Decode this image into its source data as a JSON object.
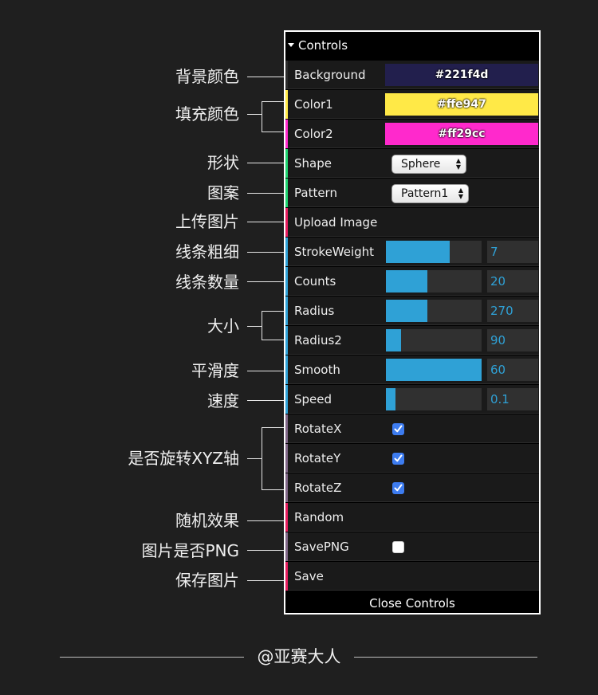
{
  "colors": {
    "background": "#1f1f1f",
    "slider_fill": "#2fa1d6",
    "panel_bg": "#1a1a1a",
    "stripe_color": "#806787",
    "stripe_boolean": "#806787",
    "stripe_number": "#2fa1d6",
    "stripe_function": "#e61d5f",
    "stripe_string": "#1ed36f"
  },
  "panel": {
    "title": "Controls",
    "close_label": "Close Controls",
    "rows": [
      {
        "label": "Background",
        "value": "#221f4d"
      },
      {
        "label": "Color1",
        "value": "#ffe947"
      },
      {
        "label": "Color2",
        "value": "#ff29cc"
      },
      {
        "label": "Shape",
        "value": "Sphere"
      },
      {
        "label": "Pattern",
        "value": "Pattern1"
      },
      {
        "label": "Upload Image"
      },
      {
        "label": "StrokeWeight",
        "value": "7",
        "fill": 0.67
      },
      {
        "label": "Counts",
        "value": "20",
        "fill": 0.43
      },
      {
        "label": "Radius",
        "value": "270",
        "fill": 0.43
      },
      {
        "label": "Radius2",
        "value": "90",
        "fill": 0.16
      },
      {
        "label": "Smooth",
        "value": "60",
        "fill": 1.0
      },
      {
        "label": "Speed",
        "value": "0.1",
        "fill": 0.1
      },
      {
        "label": "RotateX",
        "checked": true
      },
      {
        "label": "RotateY",
        "checked": true
      },
      {
        "label": "RotateZ",
        "checked": true
      },
      {
        "label": "Random"
      },
      {
        "label": "SavePNG",
        "checked": false
      },
      {
        "label": "Save"
      }
    ]
  },
  "annotations": [
    "背景颜色",
    "填充颜色",
    "形状",
    "图案",
    "上传图片",
    "线条粗细",
    "线条数量",
    "大小",
    "平滑度",
    "速度",
    "是否旋转XYZ轴",
    "随机效果",
    "图片是否PNG",
    "保存图片"
  ],
  "footer": "@亚赛大人"
}
